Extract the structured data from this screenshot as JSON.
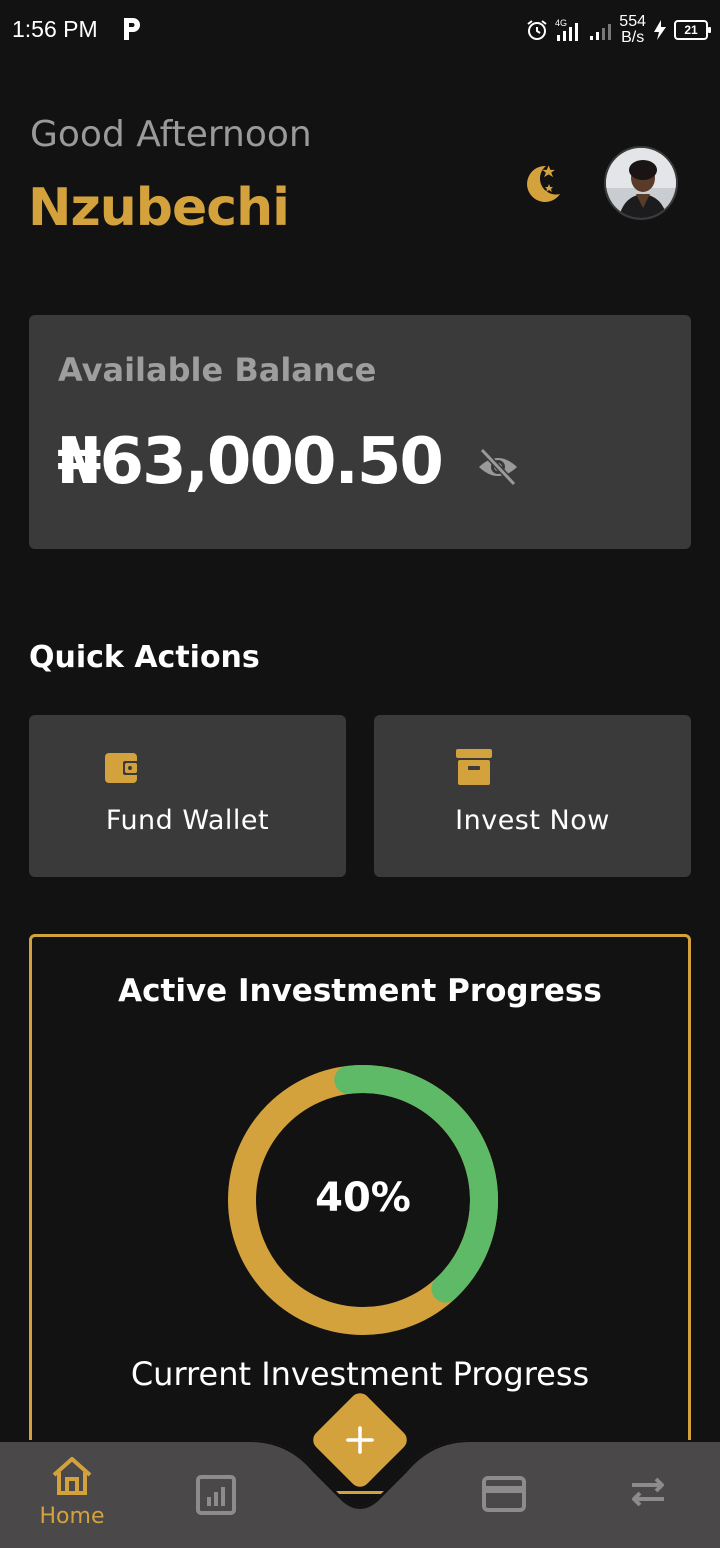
{
  "status_bar": {
    "time": "1:56 PM",
    "network_speed_value": "554",
    "network_speed_unit": "B/s",
    "network_type": "4G",
    "battery": "21"
  },
  "header": {
    "greeting": "Good Afternoon",
    "username": "Nzubechi"
  },
  "balance": {
    "label": "Available Balance",
    "amount": "₦63,000.50"
  },
  "quick_actions": {
    "title": "Quick Actions",
    "items": [
      {
        "label": "Fund Wallet",
        "icon": "wallet-icon"
      },
      {
        "label": "Invest Now",
        "icon": "archive-box-icon"
      }
    ]
  },
  "investment_progress": {
    "title": "Active Investment Progress",
    "value_label": "40%",
    "progress": 0.4,
    "subtitle": "Current Investment Progress"
  },
  "bottom_nav": {
    "items": [
      {
        "label": "Home",
        "icon": "home-icon",
        "active": true
      },
      {
        "label": "",
        "icon": "chart-icon",
        "active": false
      },
      {
        "label": "",
        "icon": "card-icon",
        "active": false
      },
      {
        "label": "",
        "icon": "transfer-icon",
        "active": false
      }
    ],
    "fab_icon": "plus-icon"
  },
  "colors": {
    "background": "#121212",
    "card": "#3a3a3a",
    "accent": "#d4a23c",
    "progress_green": "#5fba68",
    "muted_text": "#9e9e9e"
  }
}
